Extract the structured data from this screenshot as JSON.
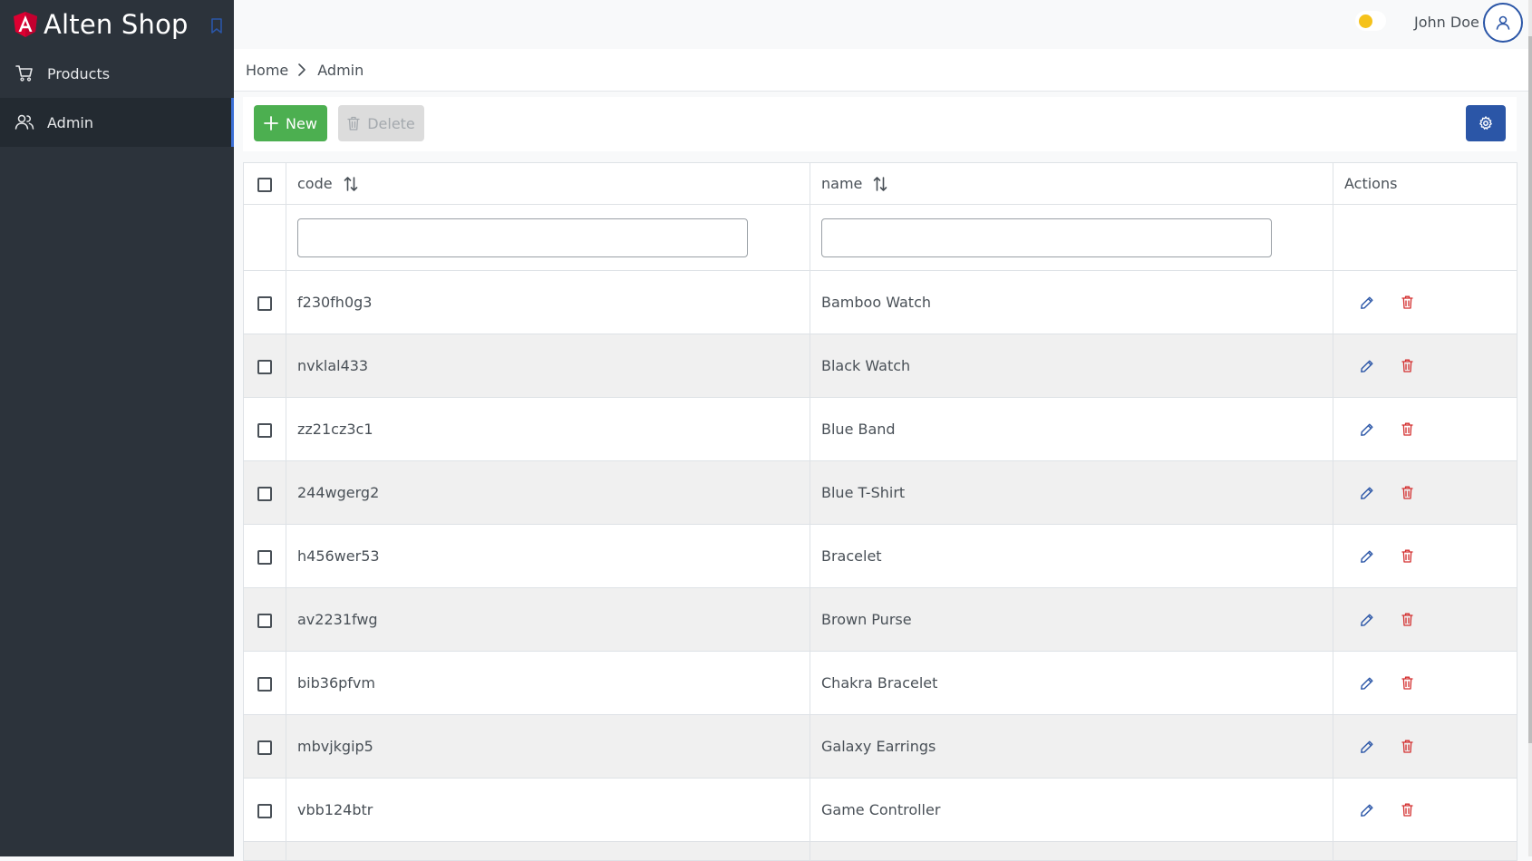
{
  "app": {
    "title": "Alten Shop"
  },
  "sidebar": {
    "items": [
      {
        "label": "Products",
        "icon": "cart-icon",
        "active": false
      },
      {
        "label": "Admin",
        "icon": "users-icon",
        "active": true
      }
    ]
  },
  "topbar": {
    "theme_toggle": {
      "state": "light",
      "color": "#f5c21b"
    },
    "user_name": "John Doe"
  },
  "breadcrumb": {
    "home": "Home",
    "current": "Admin"
  },
  "toolbar": {
    "new_label": "New",
    "delete_label": "Delete",
    "delete_enabled": false
  },
  "table": {
    "columns": {
      "code": "code",
      "name": "name",
      "actions": "Actions"
    },
    "filters": {
      "code": "",
      "name": ""
    },
    "rows": [
      {
        "code": "f230fh0g3",
        "name": "Bamboo Watch"
      },
      {
        "code": "nvklal433",
        "name": "Black Watch"
      },
      {
        "code": "zz21cz3c1",
        "name": "Blue Band"
      },
      {
        "code": "244wgerg2",
        "name": "Blue T-Shirt"
      },
      {
        "code": "h456wer53",
        "name": "Bracelet"
      },
      {
        "code": "av2231fwg",
        "name": "Brown Purse"
      },
      {
        "code": "bib36pfvm",
        "name": "Chakra Bracelet"
      },
      {
        "code": "mbvjkgip5",
        "name": "Galaxy Earrings"
      },
      {
        "code": "vbb124btr",
        "name": "Game Controller"
      }
    ]
  },
  "colors": {
    "sidebar_bg": "#2c333b",
    "primary": "#2b56a7",
    "success": "#4caf50",
    "danger": "#d32f2f",
    "edit_icon": "#2b56a7"
  }
}
